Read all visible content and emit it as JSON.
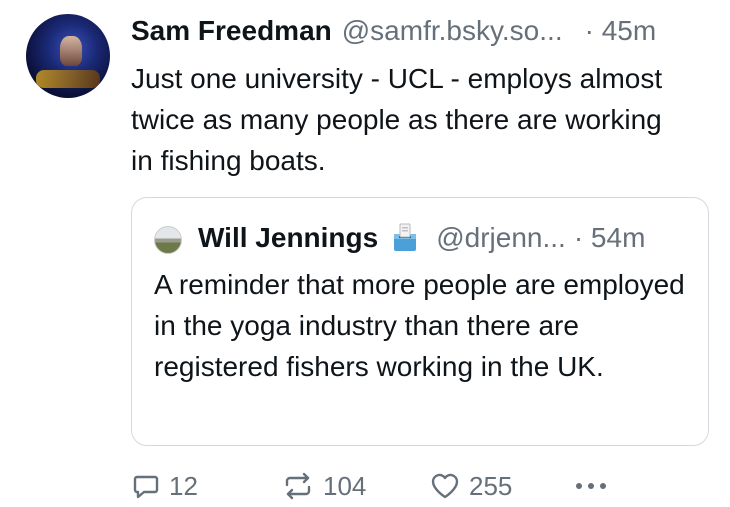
{
  "post": {
    "author_name": "Sam Freedman",
    "author_handle": "@samfr.bsky.so...",
    "time": "· 45m",
    "text": "Just one university - UCL -  employs almost twice as many people as there are working in fishing boats."
  },
  "quote": {
    "author_name": "Will Jennings",
    "badge_icon": "ballot-box-emoji",
    "author_handle": "@drjenn...",
    "time": "· 54m",
    "text": "A reminder that more people are employed in the yoga industry than there are registered fishers working in the UK."
  },
  "actions": {
    "replies": "12",
    "reposts": "104",
    "likes": "255",
    "more_icon": "more-dots-icon"
  },
  "colors": {
    "text": "#0f1419",
    "muted": "#66707a",
    "border": "#d3d9de"
  }
}
